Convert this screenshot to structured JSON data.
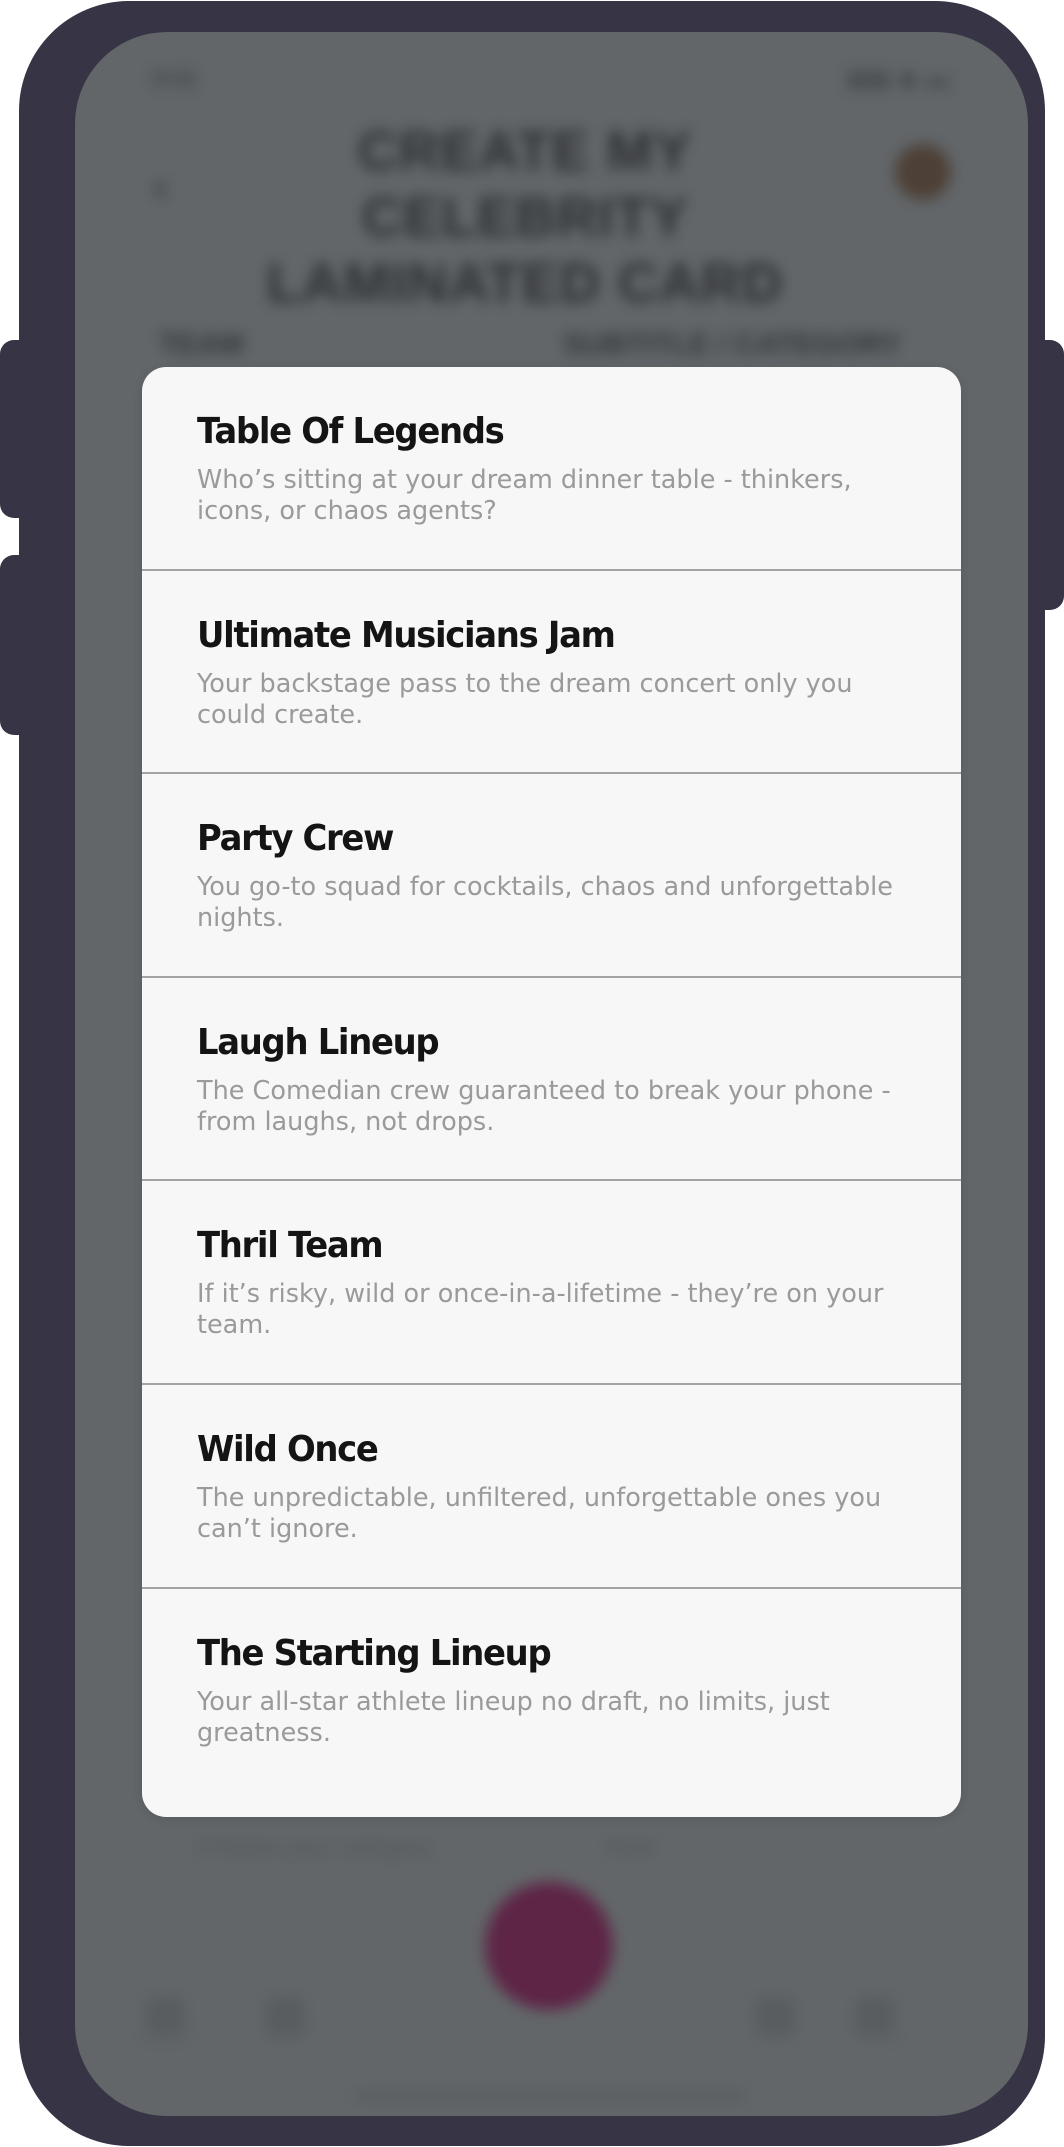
{
  "background_app": {
    "status_time": "9:41",
    "status_right": "▮▮▮ ◆ ▬",
    "back_icon": "‹",
    "title": "CREATE MY CELEBRITY LAMINATED CARD",
    "label_left": "TEAM",
    "label_right": "SUBTITLE / CATEGORY",
    "bottom_left_text": "Choose your category",
    "bottom_right_text": "Next"
  },
  "modal": {
    "options": [
      {
        "title": "Table Of Legends",
        "description": "Who’s sitting at your dream dinner table - thinkers, icons, or chaos agents?"
      },
      {
        "title": "Ultimate Musicians Jam",
        "description": "Your backstage pass to the dream concert only you could create."
      },
      {
        "title": "Party Crew",
        "description": "You go-to squad for cocktails, chaos and unforgettable nights."
      },
      {
        "title": "Laugh Lineup",
        "description": "The Comedian crew guaranteed to break your phone - from laughs, not drops."
      },
      {
        "title": "Thril Team",
        "description": "If it’s risky, wild or once-in-a-lifetime - they’re on your team."
      },
      {
        "title": "Wild Once",
        "description": "The unpredictable, unfiltered, unforgettable ones you can’t ignore."
      },
      {
        "title": "The Starting Lineup",
        "description": "Your all-star athlete lineup no draft, no limits, just greatness."
      }
    ]
  },
  "colors": {
    "frame": "#363445",
    "overlay": "#626669",
    "sheet": "#f7f7f7",
    "title_text": "#141414",
    "description_text": "#9a9a9a",
    "divider": "#a3a3a3",
    "fab": "#5e1a40"
  }
}
